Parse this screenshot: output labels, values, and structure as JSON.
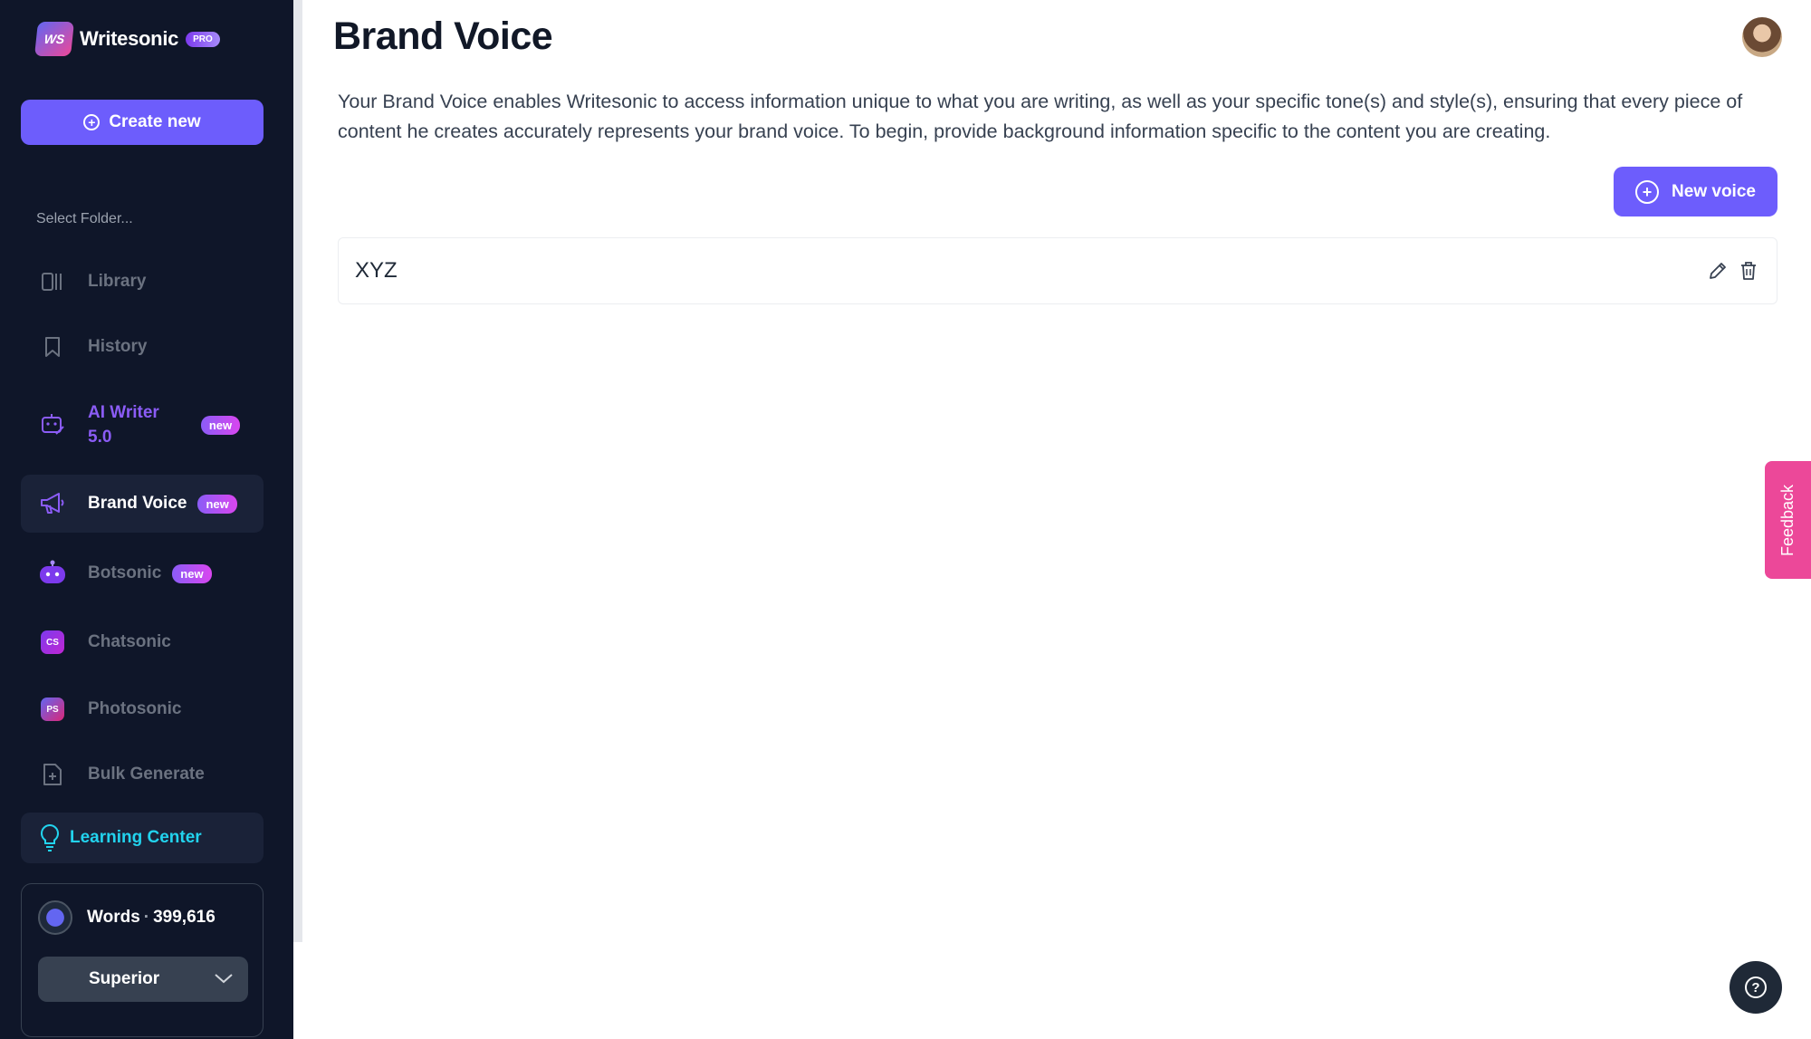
{
  "app": {
    "logo_mark": "WS",
    "name": "Writesonic",
    "plan_badge": "PRO"
  },
  "sidebar": {
    "create_button": "Create new",
    "folder_label": "Select Folder...",
    "items": [
      {
        "label": "Library",
        "icon": "library-icon"
      },
      {
        "label": "History",
        "icon": "bookmark-icon"
      },
      {
        "label": "AI Writer 5.0",
        "line1": "AI Writer",
        "line2": "5.0",
        "icon": "ai-writer-icon",
        "badge": "new"
      },
      {
        "label": "Brand Voice",
        "icon": "megaphone-icon",
        "badge": "new",
        "active": true
      },
      {
        "label": "Botsonic",
        "icon": "bot-icon",
        "badge": "new"
      },
      {
        "label": "Chatsonic",
        "icon": "chatsonic-icon",
        "badge_text": "CS"
      },
      {
        "label": "Photosonic",
        "icon": "photosonic-icon",
        "badge_text": "PS"
      },
      {
        "label": "Bulk Generate",
        "icon": "file-plus-icon"
      }
    ],
    "learning_center": "Learning Center",
    "words": {
      "label": "Words",
      "count": "399,616",
      "plan": "Superior"
    }
  },
  "main": {
    "title": "Brand Voice",
    "description": "Your Brand Voice enables Writesonic to access information unique to what you are writing, as well as your specific tone(s) and style(s), ensuring that every piece of content he creates accurately represents your brand voice. To begin, provide background information specific to the content you are creating.",
    "new_voice_button": "New voice",
    "voices": [
      {
        "name": "XYZ"
      }
    ]
  },
  "feedback_tab": "Feedback",
  "colors": {
    "sidebar_bg": "#0f1629",
    "primary": "#6d5dfc",
    "feedback": "#ec4899",
    "learning_center": "#22d3ee"
  }
}
